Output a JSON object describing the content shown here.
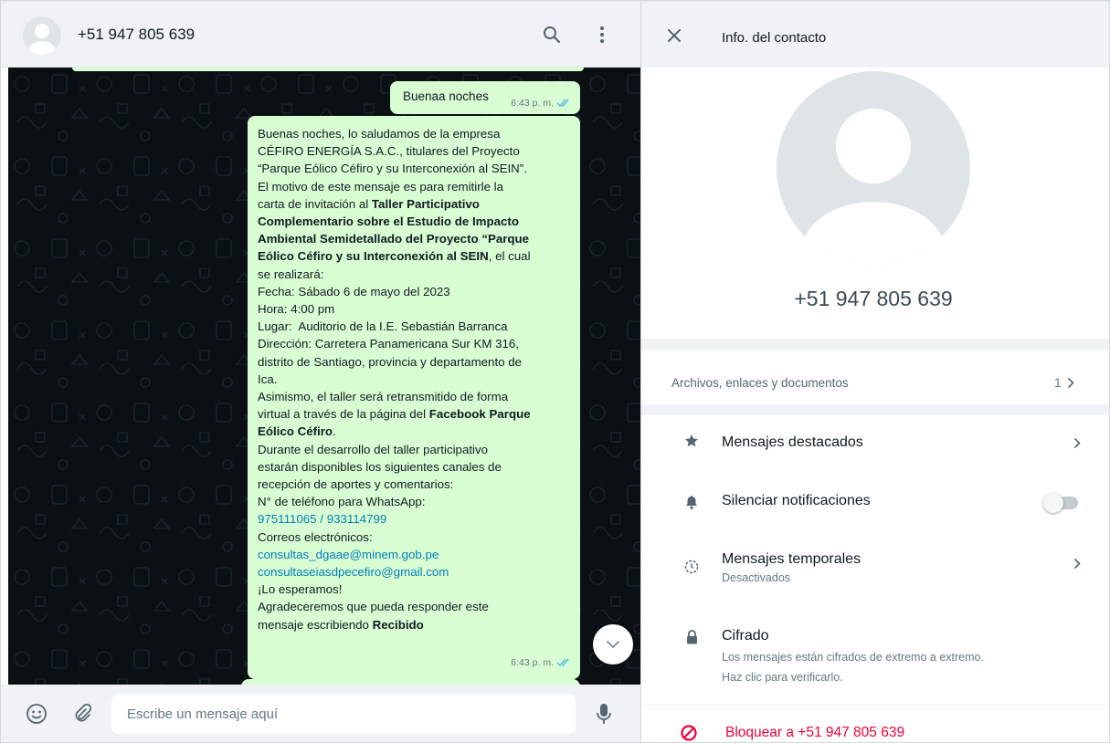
{
  "chat": {
    "contact_name": "+51 947 805 639",
    "icons": {
      "avatar": "default-avatar-icon",
      "search": "search-icon",
      "menu": "kebab-menu-icon"
    },
    "messages": [
      {
        "text": "Buenaa noches",
        "time": "6:43 p. m.",
        "status": "read-double-check"
      },
      {
        "time": "6:43 p. m.",
        "status": "read-double-check",
        "lines": [
          "Buenas noches, lo saludamos de la empresa",
          "CÉFIRO ENERGÍA S.A.C., titulares del Proyecto",
          "“Parque Eólico Céfiro y su Interconexión al SEIN”.",
          "El motivo de este mensaje es para remitirle la",
          "carta de invitación al ",
          "Taller Participativo",
          "Complementario sobre el Estudio de Impacto",
          "Ambiental Semidetallado del Proyecto “Parque",
          "Eólico Céfiro y su Interconexión al SEIN",
          ", el cual",
          "se realizará:",
          "Fecha: Sábado 6 de mayo del 2023",
          "Hora: 4:00 pm",
          "Lugar:  Auditorio de la I.E. Sebastián Barranca",
          "Dirección: Carretera Panamericana Sur KM 316,",
          "distrito de Santiago, provincia y departamento de",
          "Ica.",
          "Asimismo, el taller será retransmitido de forma",
          "virtual a través de la página del ",
          "Facebook Parque",
          "Eólico Céfiro",
          ".",
          "Durante el desarrollo del taller participativo",
          "estarán disponibles los siguientes canales de",
          "recepción de aportes y comentarios:",
          "N° de teléfono para WhatsApp:",
          "975111065",
          " / ",
          "933114799",
          "Correos electrónicos:",
          "consultas_dgaae@minem.gob.pe",
          "consultaseiasdpecefiro@gmail.com",
          "¡Lo esperamos!",
          "Agradeceremos que pueda responder este",
          "mensaje escribiendo ",
          "Recibido"
        ]
      }
    ],
    "scroll_down_icon": "chevron-down-icon"
  },
  "composer": {
    "placeholder": "Escribe un mensaje aquí",
    "value": "",
    "icons": {
      "emoji": "emoji-icon",
      "attach": "paperclip-icon",
      "mic": "microphone-icon"
    }
  },
  "contact_info": {
    "title": "Info. del contacto",
    "close_icon": "close-icon",
    "phone": "+51 947 805 639",
    "files": {
      "label": "Archivos, enlaces y documentos",
      "count": "1"
    },
    "starred": {
      "label": "Mensajes destacados",
      "icon": "star-icon"
    },
    "mute": {
      "label": "Silenciar notificaciones",
      "icon": "bell-icon",
      "enabled": false
    },
    "disappearing": {
      "label": "Mensajes temporales",
      "sub": "Desactivados",
      "icon": "timer-icon"
    },
    "encryption": {
      "label": "Cifrado",
      "sub_line1": "Los mensajes están cifrados de extremo a extremo.",
      "sub_line2": "Haz clic para verificarlo.",
      "icon": "lock-icon"
    },
    "block": {
      "label": "Bloquear a +51 947 805 639",
      "icon": "block-icon"
    }
  },
  "colors": {
    "outgoing_bubble": "#d9fdd3",
    "chat_background": "#0b1014",
    "panel_background": "#f0f2f5",
    "link": "#027eb5",
    "read_ticks": "#53bdeb",
    "danger": "#ea0038"
  }
}
